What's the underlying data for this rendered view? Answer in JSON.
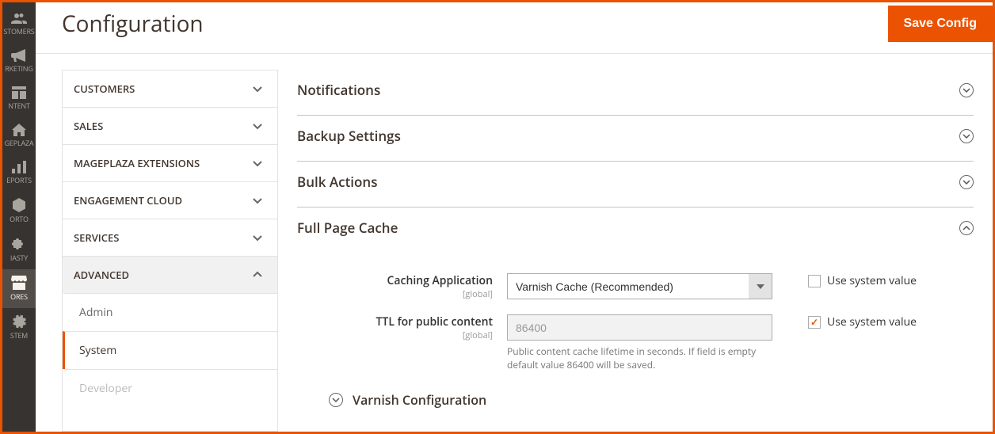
{
  "admin_nav": {
    "items": [
      {
        "label": "STOMERS"
      },
      {
        "label": "RKETING"
      },
      {
        "label": "NTENT"
      },
      {
        "label": "GEPLAZA"
      },
      {
        "label": "EPORTS"
      },
      {
        "label": "ORTO"
      },
      {
        "label": "IASTY"
      },
      {
        "label": "ORES"
      },
      {
        "label": "STEM"
      }
    ]
  },
  "page": {
    "title": "Configuration",
    "save_button": "Save Config"
  },
  "config_sidebar": {
    "groups": [
      {
        "label": "CUSTOMERS"
      },
      {
        "label": "SALES"
      },
      {
        "label": "MAGEPLAZA EXTENSIONS"
      },
      {
        "label": "ENGAGEMENT CLOUD"
      },
      {
        "label": "SERVICES"
      },
      {
        "label": "ADVANCED"
      }
    ],
    "advanced_items": [
      {
        "label": "Admin"
      },
      {
        "label": "System"
      },
      {
        "label": "Developer"
      }
    ]
  },
  "sections": {
    "notifications": {
      "title": "Notifications"
    },
    "backup": {
      "title": "Backup Settings"
    },
    "bulk": {
      "title": "Bulk Actions"
    },
    "fpc": {
      "title": "Full Page Cache",
      "caching_app_label": "Caching Application",
      "caching_app_scope": "[global]",
      "caching_app_value": "Varnish Cache (Recommended)",
      "ttl_label": "TTL for public content",
      "ttl_scope": "[global]",
      "ttl_value": "86400",
      "ttl_note": "Public content cache lifetime in seconds. If field is empty default value 86400 will be saved.",
      "use_system_label": "Use system value",
      "varnish_config": "Varnish Configuration"
    }
  }
}
